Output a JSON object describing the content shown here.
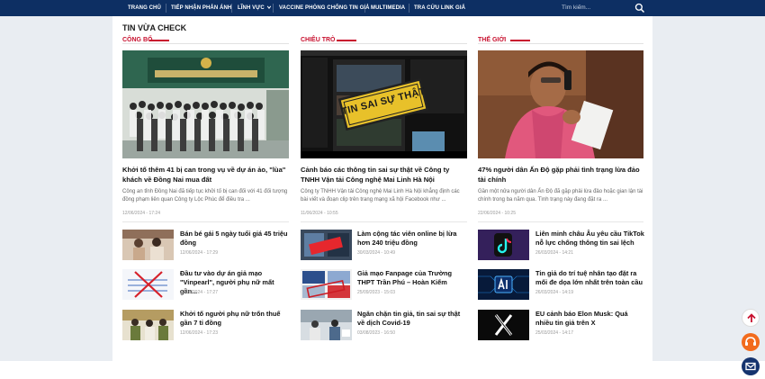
{
  "nav": {
    "items": [
      "TRANG CHỦ",
      "TIẾP NHẬN PHẢN ÁNH",
      "LĨNH VỰC",
      "VACCINE PHÒNG CHỐNG TIN GIẢ",
      "MULTIMEDIA",
      "TRA CỨU LINK GIẢ"
    ],
    "search_placeholder": "Tìm kiếm..."
  },
  "section": {
    "title": "TIN VỪA CHECK"
  },
  "columns": [
    {
      "category": "CÔNG BỐ",
      "hero": {
        "title": "Khởi tố thêm 41 bị can trong vụ về dự án ảo, \"lùa\" khách về Đồng Nai mua đất",
        "summary": "Công an tỉnh Đồng Nai đã tiếp tục khởi tố bị can đối với 41 đối tượng đồng phạm liên quan Công ty Lộc Phúc để điều tra ...",
        "time": "12/06/2024 - 17:24"
      },
      "items": [
        {
          "title": "Bán bé gái 5 ngày tuổi giá 45 triệu đồng",
          "time": "12/06/2024 - 17:29"
        },
        {
          "title": "Đầu tư vào dự án giả mạo \"Vinpearl\", người phụ nữ mất gần...",
          "time": "12/06/2024 - 17:27"
        },
        {
          "title": "Khởi tố người phụ nữ trốn thuế gần 7 tỉ đồng",
          "time": "12/06/2024 - 17:23"
        }
      ]
    },
    {
      "category": "CHIÊU TRÒ",
      "hero": {
        "title": "Cảnh báo các thông tin sai sự thật về Công ty TNHH Vận tải Công nghệ Mai Linh Hà Nội",
        "summary": "Công ty TNHH Vận tải Công nghệ Mai Linh Hà Nội khẳng định các bài viết và đoạn clip trên trang mạng xã hội Facebook như ...",
        "time": "11/06/2024 - 10:55",
        "stamp": "TIN SAI SỰ THẬT"
      },
      "items": [
        {
          "title": "Làm cộng tác viên online bị lừa hơn 240 triệu đồng",
          "time": "30/03/2024 - 10:49"
        },
        {
          "title": "Giả mạo Fanpage của Trường THPT Trần Phú – Hoàn Kiếm",
          "time": "25/09/2023 - 15:03"
        },
        {
          "title": "Ngăn chặn tin giả, tin sai sự thật về dịch Covid-19",
          "time": "03/08/2023 - 16:50"
        }
      ]
    },
    {
      "category": "THẾ GIỚI",
      "hero": {
        "title": "47% người dân Ấn Độ gặp phải tình trạng lừa đảo tài chính",
        "summary": "Gần một nửa người dân Ấn Độ đã gặp phải lừa đảo hoặc gian lận tài chính trong ba năm qua. Tình trạng này đang đặt ra ...",
        "time": "22/06/2024 - 10:25"
      },
      "items": [
        {
          "title": "Liên minh châu Âu yêu cầu TikTok nỗ lực chống thông tin sai lệch",
          "time": "26/03/2024 - 14:21"
        },
        {
          "title": "Tin giả do trí tuệ nhân tạo đặt ra mối đe dọa lớn nhất trên toàn cầu",
          "time": "26/03/2024 - 14:19"
        },
        {
          "title": "EU cảnh báo Elon Musk: Quá nhiều tin giả trên X",
          "time": "25/03/2024 - 14:17"
        }
      ]
    }
  ],
  "colors": {
    "nav_bg": "#0d2f63",
    "accent": "#c8102e",
    "fab_orange": "#f26b1d",
    "fab_navy": "#14336e"
  }
}
